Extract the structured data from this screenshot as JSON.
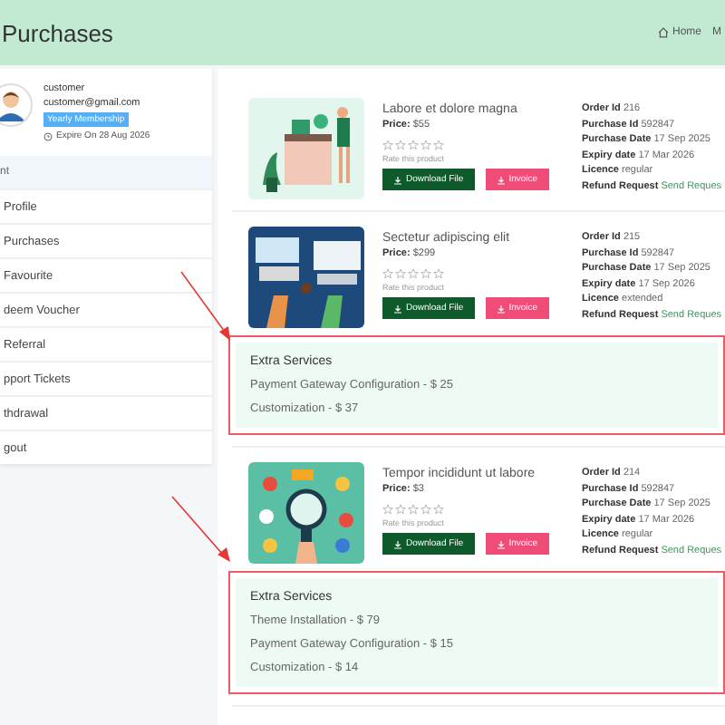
{
  "page": {
    "title": "Purchases"
  },
  "breadcrumb": [
    "Home",
    "M"
  ],
  "profile": {
    "name": "customer",
    "email": "customer@gmail.com",
    "badge": "Yearly Membership",
    "expiry": "Expire On 28 Aug 2026"
  },
  "menu": {
    "heading": "nt",
    "items": [
      "Profile",
      "Purchases",
      "Favourite",
      "deem Voucher",
      "Referral",
      "pport Tickets",
      "thdrawal",
      "gout"
    ]
  },
  "purchases": [
    {
      "title": "Labore et dolore magna",
      "price_label": "Price:",
      "price": "$55",
      "stars": 0,
      "rate_label": "Rate this product",
      "buttons": [
        {
          "kind": "download",
          "label": "Download File"
        },
        {
          "kind": "invoice",
          "label": "Invoice"
        }
      ],
      "details": [
        {
          "label": "Order Id",
          "value": "216"
        },
        {
          "label": "Purchase Id",
          "value": "592847"
        },
        {
          "label": "Purchase Date",
          "value": "17 Sep 2025"
        },
        {
          "label": "Expiry date",
          "value": "17 Mar 2026"
        },
        {
          "label": "Licence",
          "value": "regular"
        },
        {
          "label": "Refund Request",
          "value": "Send Reques",
          "kind": "link"
        }
      ]
    },
    {
      "title": "Sectetur adipiscing elit",
      "price_label": "Price:",
      "price": "$299",
      "stars": 0,
      "rate_label": "Rate this product",
      "buttons": [
        {
          "kind": "download",
          "label": "Download File"
        },
        {
          "kind": "invoice",
          "label": "Invoice"
        }
      ],
      "details": [
        {
          "label": "Order Id",
          "value": "215"
        },
        {
          "label": "Purchase Id",
          "value": "592847"
        },
        {
          "label": "Purchase Date",
          "value": "17 Sep 2025"
        },
        {
          "label": "Expiry date",
          "value": "17 Sep 2026"
        },
        {
          "label": "Licence",
          "value": "extended"
        },
        {
          "label": "Refund Request",
          "value": "Send Reques",
          "kind": "link"
        }
      ],
      "extra_services": {
        "title": "Extra Services",
        "items": [
          "Payment Gateway Configuration - $ 25",
          "Customization - $ 37"
        ]
      }
    },
    {
      "title": "Tempor incididunt ut labore",
      "price_label": "Price:",
      "price": "$3",
      "stars": 0,
      "rate_label": "Rate this product",
      "buttons": [
        {
          "kind": "download",
          "label": "Download File"
        },
        {
          "kind": "invoice",
          "label": "Invoice"
        }
      ],
      "details": [
        {
          "label": "Order Id",
          "value": "214"
        },
        {
          "label": "Purchase Id",
          "value": "592847"
        },
        {
          "label": "Purchase Date",
          "value": "17 Sep 2025"
        },
        {
          "label": "Expiry date",
          "value": "17 Mar 2026"
        },
        {
          "label": "Licence",
          "value": "regular"
        },
        {
          "label": "Refund Request",
          "value": "Send Reques",
          "kind": "link"
        }
      ],
      "extra_services": {
        "title": "Extra Services",
        "items": [
          "Theme Installation - $ 79",
          "Payment Gateway Configuration - $ 15",
          "Customization - $ 14"
        ]
      }
    }
  ]
}
